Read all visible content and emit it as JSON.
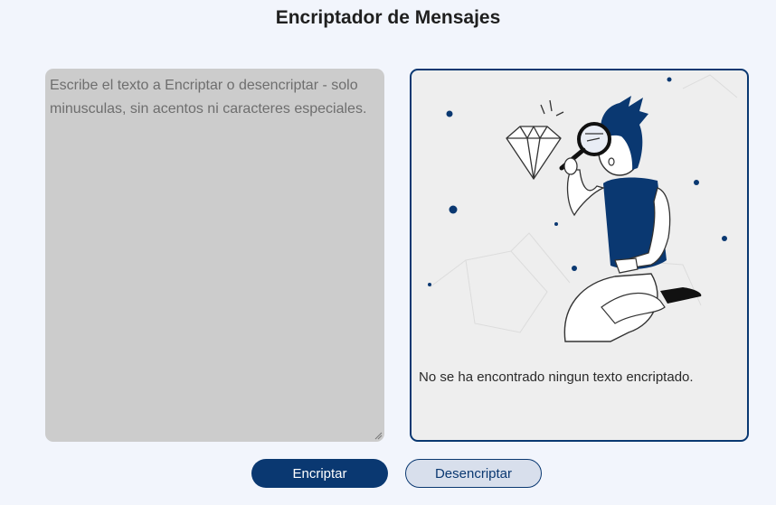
{
  "header": {
    "title": "Encriptador de Mensajes"
  },
  "input": {
    "placeholder": "Escribe el texto a Encriptar o desencriptar - solo minusculas, sin acentos ni caracteres especiales.",
    "value": ""
  },
  "output": {
    "illustration_icon": "person-with-magnifying-glass-and-diamond",
    "message": "No se ha encontrado ningun texto encriptado."
  },
  "buttons": {
    "encrypt_label": "Encriptar",
    "decrypt_label": "Desencriptar"
  },
  "colors": {
    "accent": "#0a3871",
    "background": "#f2f5fc",
    "input_background": "#cccccc",
    "output_background": "#eeeeee",
    "secondary_button": "#d8dfec"
  }
}
